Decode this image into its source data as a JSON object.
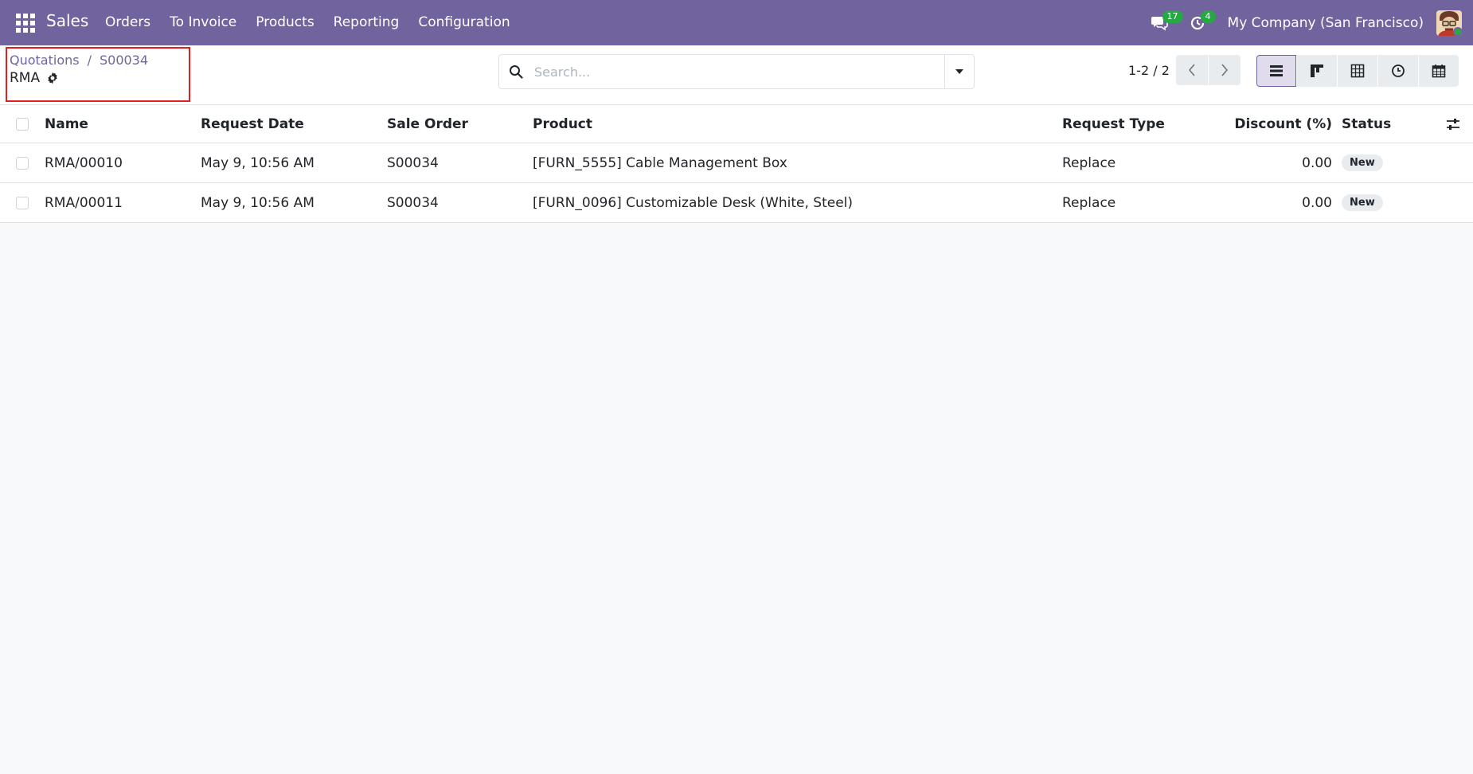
{
  "navbar": {
    "app_name": "Sales",
    "menu": [
      "Orders",
      "To Invoice",
      "Products",
      "Reporting",
      "Configuration"
    ],
    "messages_count": "17",
    "activities_count": "4",
    "company": "My Company (San Francisco)",
    "brand_color": "#71639e"
  },
  "breadcrumb": {
    "items": [
      "Quotations",
      "S00034"
    ],
    "separator": "/",
    "current": "RMA"
  },
  "search": {
    "placeholder": "Search...",
    "value": ""
  },
  "pager": {
    "value": "1-2 / 2"
  },
  "views": [
    "list-icon",
    "kanban-icon",
    "pivot-icon",
    "activity-icon",
    "calendar-icon"
  ],
  "table": {
    "columns": [
      "Name",
      "Request Date",
      "Sale Order",
      "Product",
      "Request Type",
      "Discount (%)",
      "Status"
    ],
    "rows": [
      {
        "name": "RMA/00010",
        "request_date": "May 9, 10:56 AM",
        "sale_order": "S00034",
        "product": "[FURN_5555] Cable Management Box",
        "request_type": "Replace",
        "discount": "0.00",
        "status": "New"
      },
      {
        "name": "RMA/00011",
        "request_date": "May 9, 10:56 AM",
        "sale_order": "S00034",
        "product": "[FURN_0096] Customizable Desk (White, Steel)",
        "request_type": "Replace",
        "discount": "0.00",
        "status": "New"
      }
    ]
  }
}
